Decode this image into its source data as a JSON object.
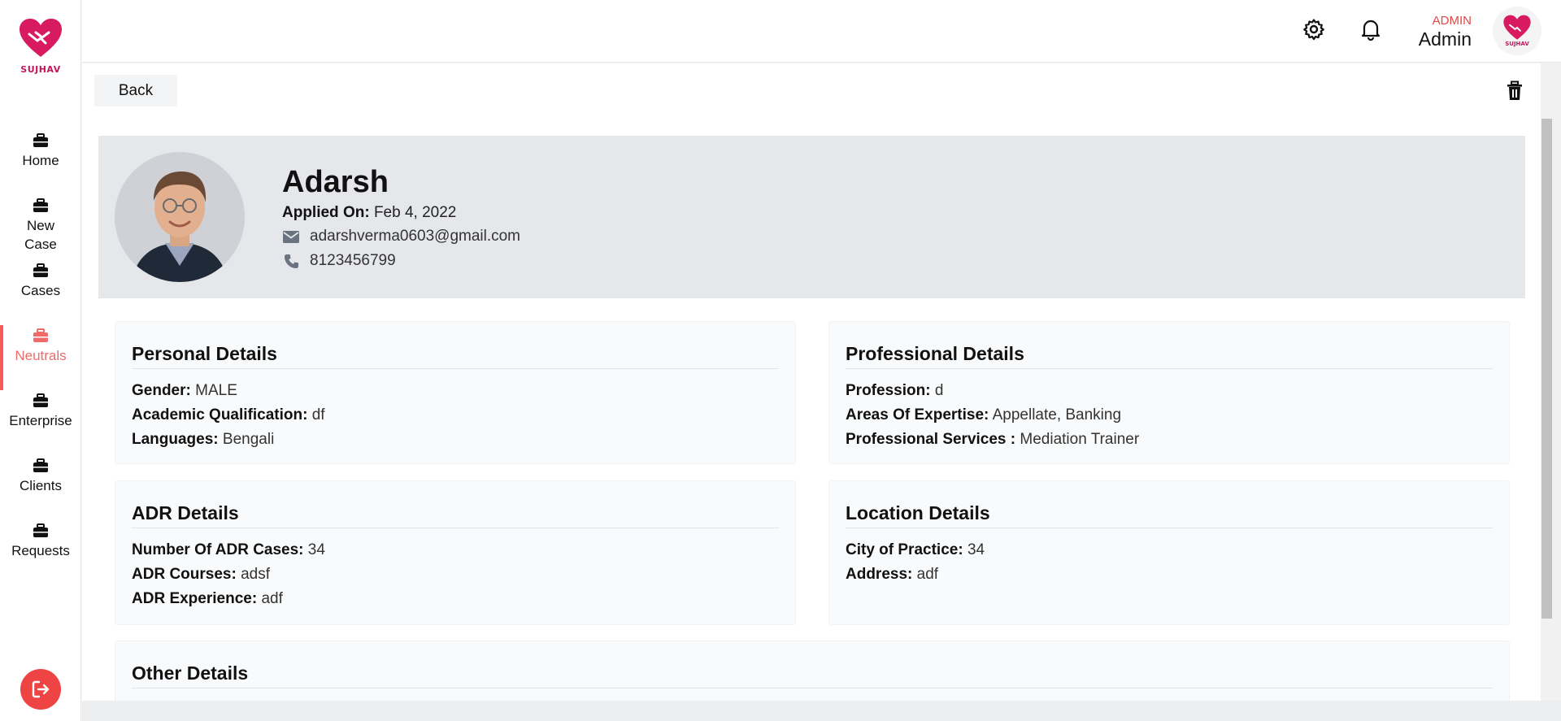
{
  "brand": {
    "logo_text": "SUJHAV",
    "accent": "#c2185b"
  },
  "sidebar": {
    "items": [
      {
        "label": "Home",
        "icon": "briefcase-icon",
        "active": false
      },
      {
        "label": "New Case",
        "icon": "briefcase-icon",
        "active": false
      },
      {
        "label": "Cases",
        "icon": "briefcase-icon",
        "active": false
      },
      {
        "label": "Neutrals",
        "icon": "briefcase-icon",
        "active": true
      },
      {
        "label": "Enterprise",
        "icon": "briefcase-icon",
        "active": false
      },
      {
        "label": "Clients",
        "icon": "briefcase-icon",
        "active": false
      },
      {
        "label": "Requests",
        "icon": "briefcase-icon",
        "active": false
      }
    ],
    "active_color": "#ef6b6b",
    "logout_icon": "logout-icon"
  },
  "header": {
    "settings_icon": "gear-icon",
    "notifications_icon": "bell-icon",
    "user_role": "ADMIN",
    "user_name": "Admin",
    "avatar_text": "SUJHAV"
  },
  "page": {
    "back_label": "Back",
    "delete_icon": "trash-icon"
  },
  "profile": {
    "name": "Adarsh",
    "applied_label": "Applied On:",
    "applied_value": "Feb 4, 2022",
    "email": "adarshverma0603@gmail.com",
    "phone": "8123456799"
  },
  "sections": {
    "personal": {
      "title": "Personal Details",
      "gender_label": "Gender:",
      "gender": "MALE",
      "qualification_label": "Academic Qualification:",
      "qualification": "df",
      "languages_label": "Languages:",
      "languages": "Bengali"
    },
    "professional": {
      "title": "Professional Details",
      "profession_label": "Profession:",
      "profession": "d",
      "expertise_label": "Areas Of Expertise:",
      "expertise": "Appellate, Banking",
      "services_label": "Professional Services :",
      "services": "Mediation Trainer"
    },
    "adr": {
      "title": "ADR Details",
      "cases_label": "Number Of ADR Cases:",
      "cases": "34",
      "courses_label": "ADR Courses:",
      "courses": "adsf",
      "experience_label": "ADR Experience:",
      "experience": "adf"
    },
    "location": {
      "title": "Location Details",
      "city_label": "City of Practice:",
      "city": "34",
      "address_label": "Address:",
      "address": "adf"
    },
    "other": {
      "title": "Other Details"
    }
  }
}
